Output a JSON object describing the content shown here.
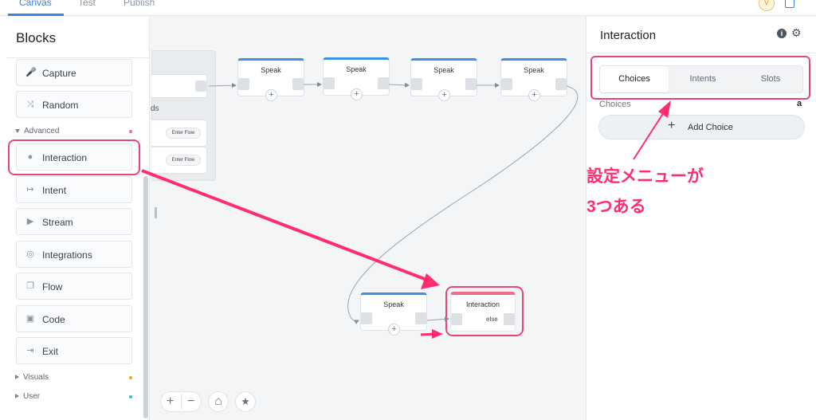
{
  "top_tabs": [
    "Canvas",
    "Test",
    "Publish"
  ],
  "user_avatar": "V",
  "sidebar": {
    "title": "Blocks",
    "items": [
      {
        "label": "Capture",
        "icon": "microphone-icon",
        "glyph": "🎤"
      },
      {
        "label": "Random",
        "icon": "shuffle-icon",
        "glyph": "⤨"
      },
      {
        "label": "Interaction",
        "icon": "user-icon",
        "glyph": "●"
      },
      {
        "label": "Intent",
        "icon": "intent-arrow-icon",
        "glyph": "↦"
      },
      {
        "label": "Stream",
        "icon": "play-icon",
        "glyph": "▶"
      },
      {
        "label": "Integrations",
        "icon": "globe-icon",
        "glyph": "◎"
      },
      {
        "label": "Flow",
        "icon": "flow-icon",
        "glyph": "❐"
      },
      {
        "label": "Code",
        "icon": "code-icon",
        "glyph": "▣"
      },
      {
        "label": "Exit",
        "icon": "exit-icon",
        "glyph": "⇥"
      }
    ],
    "sections": [
      "Advanced",
      "Visuals",
      "User"
    ],
    "section_colors": [
      "#f26d86",
      "#f5a623",
      "#20c9c0"
    ]
  },
  "canvas": {
    "group_text": "ds",
    "enter_flow": [
      "Enter Flow",
      "Enter Flow"
    ],
    "speak_nodes": [
      "Speak",
      "Speak",
      "Speak",
      "Speak",
      "Speak"
    ],
    "interaction_node": {
      "title": "Interaction",
      "else": "else"
    },
    "controls": {
      "zoom_in": "+",
      "zoom_out": "−",
      "home": "⌂",
      "star": "★"
    }
  },
  "panel": {
    "title": "Interaction",
    "tabs": [
      "Choices",
      "Intents",
      "Slots"
    ],
    "active_tab": "Choices",
    "choices_label": "Choices",
    "amazon_glyph": "a",
    "add_choice": "Add Choice"
  },
  "annotation": {
    "line1": "設定メニューが",
    "line2": "3つある",
    "color": "#ff2d6e"
  }
}
